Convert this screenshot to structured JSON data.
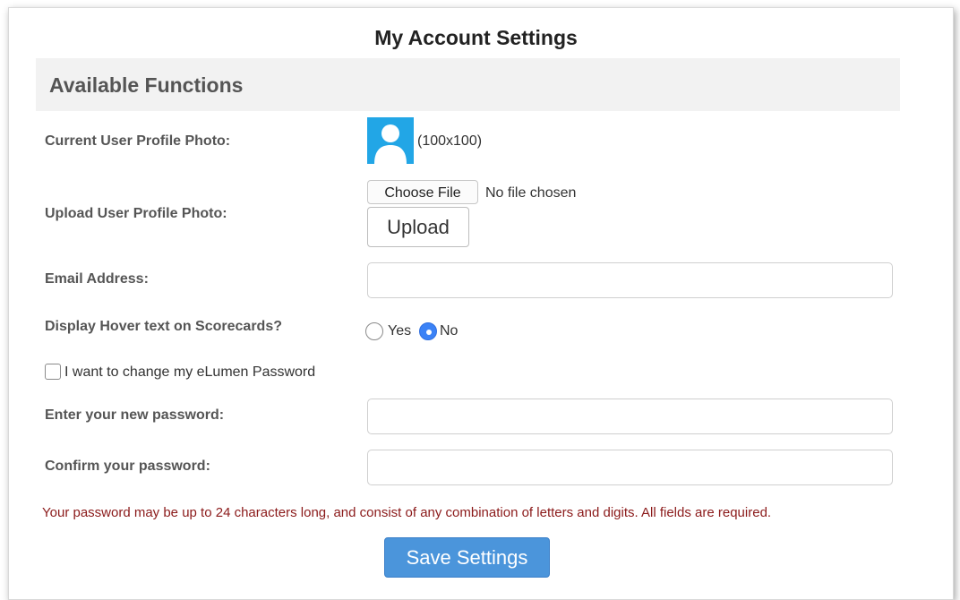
{
  "page": {
    "title": "My Account Settings"
  },
  "section": {
    "header": "Available Functions"
  },
  "profile_photo": {
    "label": "Current User Profile Photo:",
    "dimensions": "(100x100)",
    "icon": "user-avatar-icon"
  },
  "upload": {
    "label": "Upload User Profile Photo:",
    "choose_file_label": "Choose File",
    "no_file_text": "No file chosen",
    "upload_button": "Upload"
  },
  "email": {
    "label": "Email Address:",
    "value": "",
    "placeholder": ""
  },
  "hover_text": {
    "label": "Display Hover text on Scorecards?",
    "options": [
      "Yes",
      "No"
    ],
    "selected": "No"
  },
  "change_password": {
    "label": "I want to change my eLumen Password",
    "checked": false
  },
  "new_password": {
    "label": "Enter your new password:",
    "value": ""
  },
  "confirm_password": {
    "label": "Confirm your password:",
    "value": ""
  },
  "note": "Your password may be up to 24 characters long, and consist of any combination of letters and digits. All fields are required.",
  "save_button": "Save Settings",
  "colors": {
    "accent": "#4b95db",
    "note": "#8b1a1a",
    "avatar": "#22a6e6",
    "radio_selected": "#3b82f6"
  }
}
